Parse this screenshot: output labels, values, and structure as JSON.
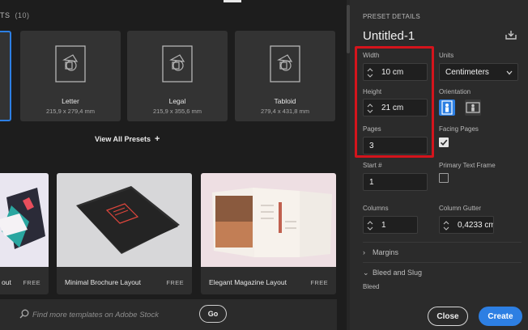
{
  "colors": {
    "accent": "#2d7fe3",
    "highlight": "#d4141c"
  },
  "presets_section": {
    "header": "TS",
    "count": "(10)",
    "view_all_label": "View All Presets",
    "view_all_icon": "plus-icon",
    "cards": [
      {
        "name": "Letter",
        "size": "215,9 x 279,4 mm"
      },
      {
        "name": "Legal",
        "size": "215,9 x 355,6 mm"
      },
      {
        "name": "Tabloid",
        "size": "279,4 x 431,8 mm"
      }
    ]
  },
  "templates": [
    {
      "name": "out",
      "badge": "FREE"
    },
    {
      "name": "Minimal Brochure Layout",
      "badge": "FREE"
    },
    {
      "name": "Elegant Magazine Layout",
      "badge": "FREE"
    }
  ],
  "search": {
    "placeholder": "Find more templates on Adobe Stock",
    "go_label": "Go"
  },
  "preset_details": {
    "heading": "PRESET DETAILS",
    "title": "Untitled-1",
    "save_icon": "save-preset-icon",
    "width": {
      "label": "Width",
      "value": "10 cm"
    },
    "height": {
      "label": "Height",
      "value": "21 cm"
    },
    "pages": {
      "label": "Pages",
      "value": "3"
    },
    "units": {
      "label": "Units",
      "value": "Centimeters"
    },
    "orientation": {
      "label": "Orientation",
      "selected": "portrait"
    },
    "facing_pages": {
      "label": "Facing Pages",
      "checked": true
    },
    "start": {
      "label": "Start #",
      "value": "1"
    },
    "primary_text_frame": {
      "label": "Primary Text Frame",
      "checked": false
    },
    "columns": {
      "label": "Columns",
      "value": "1"
    },
    "column_gutter": {
      "label": "Column Gutter",
      "value": "0,4233 cm"
    },
    "margins_label": "Margins",
    "bleed_slug_label": "Bleed and Slug",
    "bleed_label": "Bleed"
  },
  "actions": {
    "close_label": "Close",
    "create_label": "Create"
  }
}
